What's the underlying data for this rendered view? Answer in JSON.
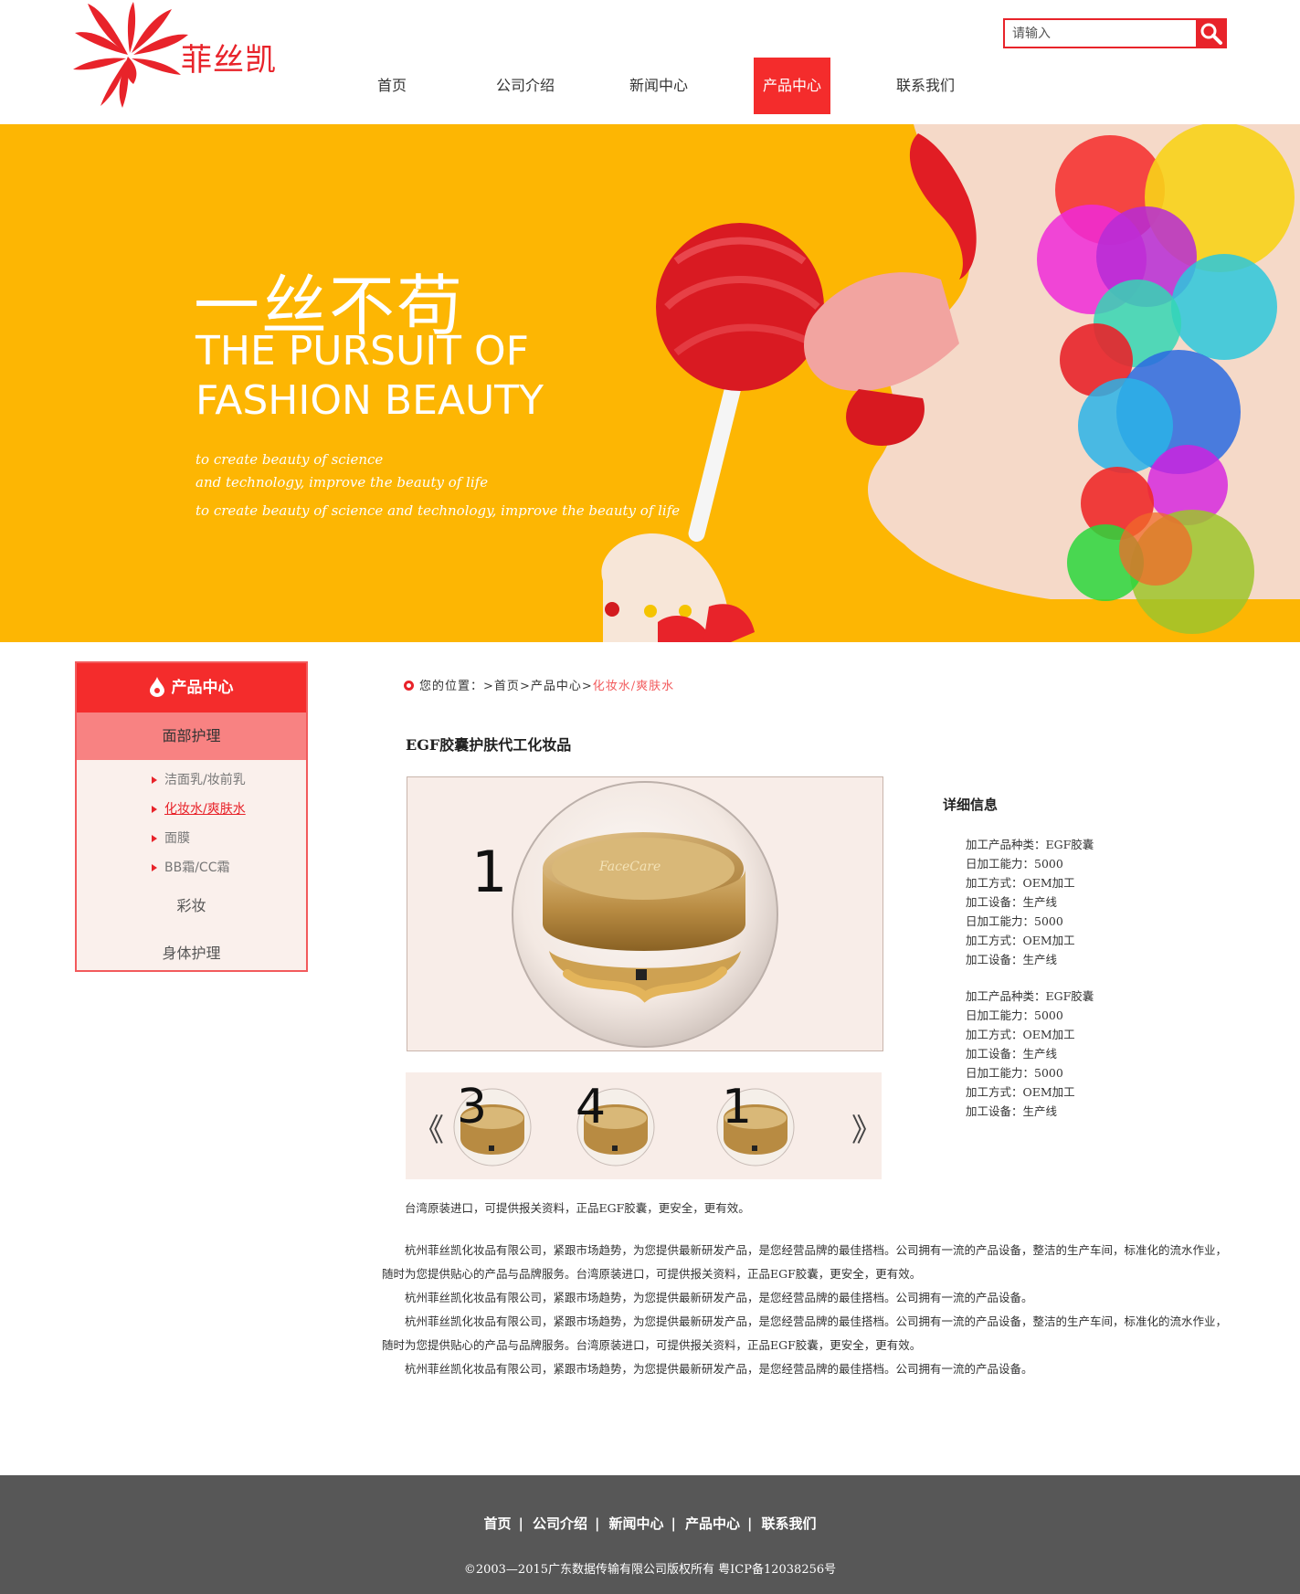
{
  "brand": {
    "name": "菲丝凯",
    "logo_color": "#e8232a"
  },
  "search": {
    "placeholder": "请输入",
    "button_icon": "magnifier-icon"
  },
  "nav": {
    "items": [
      {
        "label": "首页",
        "active": false
      },
      {
        "label": "公司介绍",
        "active": false
      },
      {
        "label": "新闻中心",
        "active": false
      },
      {
        "label": "产品中心",
        "active": true
      },
      {
        "label": "联系我们",
        "active": false
      }
    ]
  },
  "banner": {
    "title_cn": "一丝不苟",
    "title_en_1": "THE PURSUIT OF",
    "title_en_2": "FASHION BEAUTY",
    "sub_1": "to create beauty of science",
    "sub_2": "and technology, improve the beauty of life",
    "sub_3": "to create beauty of science and technology, improve the beauty of life",
    "background_color": "#fdb603"
  },
  "sidebar": {
    "title": "产品中心",
    "categories": [
      {
        "label": "面部护理",
        "open": true
      },
      {
        "label": "彩妆",
        "open": false
      },
      {
        "label": "身体护理",
        "open": false
      }
    ],
    "sub_items": [
      {
        "label": "洁面乳/妆前乳",
        "current": false
      },
      {
        "label": "化妆水/爽肤水",
        "current": true
      },
      {
        "label": "面膜",
        "current": false
      },
      {
        "label": "BB霜/CC霜",
        "current": false
      }
    ]
  },
  "breadcrumb": {
    "prefix": "您的位置：",
    "sep": ">",
    "home": "首页",
    "section": "产品中心",
    "current": "化妆水/爽肤水"
  },
  "product": {
    "title": "EGF胶囊护肤代工化妆品",
    "main_image_number": "1",
    "jar_brand": "FaceCare",
    "thumbnails": [
      "3",
      "4",
      "1"
    ],
    "prev_label": "《",
    "next_label": "》"
  },
  "details": {
    "heading": "详细信息",
    "group_1": [
      "加工产品种类：EGF胶囊",
      "日加工能力：5000",
      "加工方式：OEM加工",
      "加工设备：生产线",
      "日加工能力：5000",
      "加工方式：OEM加工",
      "加工设备：生产线"
    ],
    "group_2": [
      "加工产品种类：EGF胶囊",
      "日加工能力：5000",
      "加工方式：OEM加工",
      "加工设备：生产线",
      "日加工能力：5000",
      "加工方式：OEM加工",
      "加工设备：生产线"
    ]
  },
  "description": {
    "intro": "台湾原装进口，可提供报关资料，正品EGF胶囊，更安全，更有效。",
    "paragraphs": [
      "杭州菲丝凯化妆品有限公司，紧跟市场趋势，为您提供最新研发产品，是您经营品牌的最佳搭档。公司拥有一流的产品设备，整洁的生产车间，标准化的流水作业，随时为您提供贴心的产品与品牌服务。台湾原装进口，可提供报关资料，正品EGF胶囊，更安全，更有效。",
      "杭州菲丝凯化妆品有限公司，紧跟市场趋势，为您提供最新研发产品，是您经营品牌的最佳搭档。公司拥有一流的产品设备。",
      "杭州菲丝凯化妆品有限公司，紧跟市场趋势，为您提供最新研发产品，是您经营品牌的最佳搭档。公司拥有一流的产品设备，整洁的生产车间，标准化的流水作业，随时为您提供贴心的产品与品牌服务。台湾原装进口，可提供报关资料，正品EGF胶囊，更安全，更有效。",
      "杭州菲丝凯化妆品有限公司，紧跟市场趋势，为您提供最新研发产品，是您经营品牌的最佳搭档。公司拥有一流的产品设备。"
    ]
  },
  "footer": {
    "links": [
      "首页",
      "公司介绍",
      "新闻中心",
      "产品中心",
      "联系我们"
    ],
    "separator": "|",
    "copyright": "©2003—2015广东数据传输有限公司版权所有  粤ICP备12038256号"
  }
}
